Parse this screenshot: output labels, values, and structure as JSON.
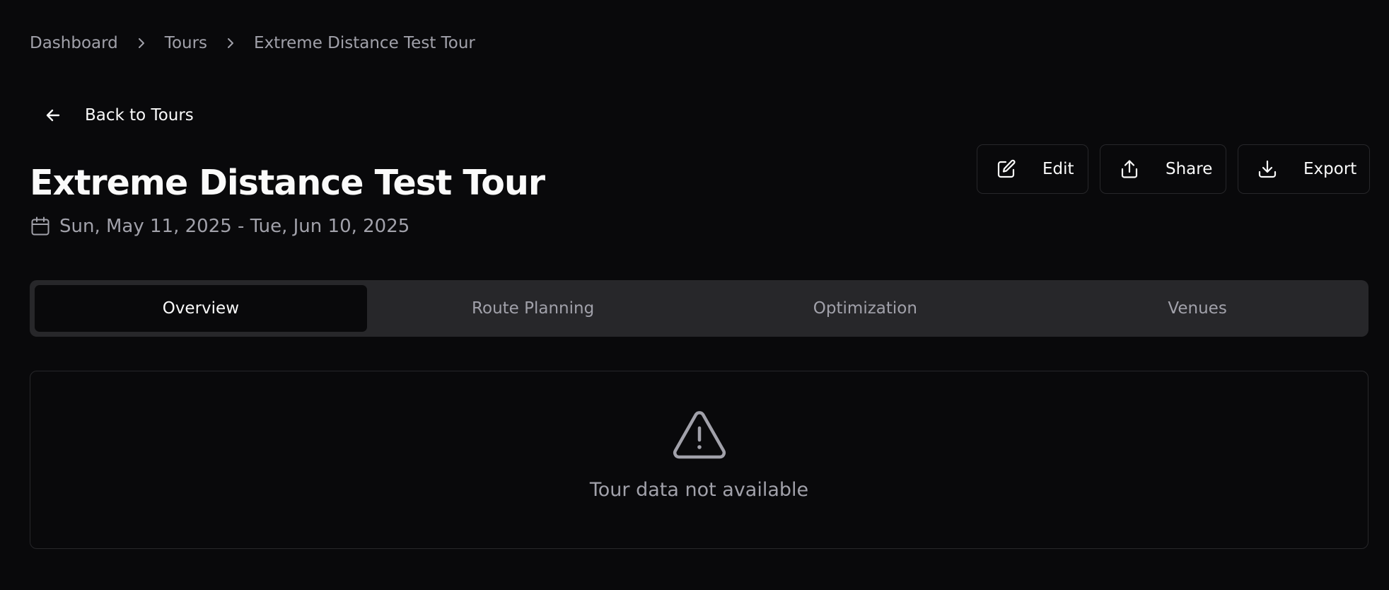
{
  "breadcrumb": {
    "items": [
      "Dashboard",
      "Tours",
      "Extreme Distance Test Tour"
    ],
    "separator_icon": "chevron-right-icon"
  },
  "back_link": {
    "label": "Back to Tours",
    "icon": "arrow-left-icon"
  },
  "tour": {
    "title": "Extreme Distance Test Tour",
    "date_range": "Sun, May 11, 2025 - Tue, Jun 10, 2025",
    "date_icon": "calendar-icon"
  },
  "actions": {
    "edit": {
      "label": "Edit",
      "icon": "pencil-square-icon"
    },
    "share": {
      "label": "Share",
      "icon": "share-upload-icon"
    },
    "export": {
      "label": "Export",
      "icon": "download-icon"
    }
  },
  "tabs": [
    {
      "label": "Overview",
      "active": true
    },
    {
      "label": "Route Planning",
      "active": false
    },
    {
      "label": "Optimization",
      "active": false
    },
    {
      "label": "Venues",
      "active": false
    }
  ],
  "empty_state": {
    "icon": "warning-triangle-icon",
    "message": "Tour data not available"
  },
  "colors": {
    "background": "#09090b",
    "foreground": "#fafafa",
    "muted": "#a1a1aa",
    "border": "#27272a",
    "tab_bar": "#27272a"
  }
}
